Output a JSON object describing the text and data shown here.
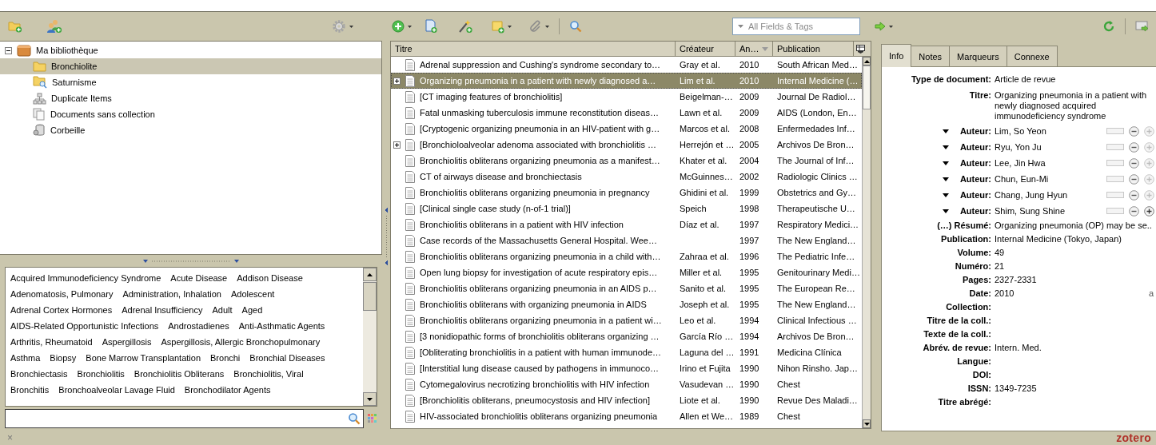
{
  "toolbar": {
    "search_placeholder": "All Fields & Tags"
  },
  "collections": [
    {
      "label": "Ma bibliothèque",
      "kind": "library",
      "expanded": true,
      "selected": false,
      "children": [
        {
          "label": "Bronchiolite",
          "kind": "folder",
          "selected": true
        },
        {
          "label": "Saturnisme",
          "kind": "saved-search",
          "selected": false
        },
        {
          "label": "Duplicate Items",
          "kind": "duplicates",
          "selected": false
        },
        {
          "label": "Documents sans collection",
          "kind": "unfiled",
          "selected": false
        },
        {
          "label": "Corbeille",
          "kind": "trash",
          "selected": false
        }
      ]
    }
  ],
  "tag_rows": [
    {
      "tags": [
        "Acquired Immunodeficiency Syndrome",
        "Acute Disease",
        "Addison Disease"
      ]
    },
    {
      "tags": [
        "Adenomatosis, Pulmonary",
        "Administration, Inhalation",
        "Adolescent"
      ]
    },
    {
      "tags": [
        "Adrenal Cortex Hormones",
        "Adrenal Insufficiency",
        "Adult",
        "Aged"
      ]
    },
    {
      "tags": [
        "AIDS-Related Opportunistic Infections",
        "Androstadienes",
        "Anti-Asthmatic Agents"
      ]
    },
    {
      "tags": [
        "Arthritis, Rheumatoid",
        "Aspergillosis",
        "Aspergillosis, Allergic Bronchopulmonary"
      ]
    },
    {
      "tags": [
        "Asthma",
        "Biopsy",
        "Bone Marrow Transplantation",
        "Bronchi",
        "Bronchial Diseases"
      ]
    },
    {
      "tags": [
        "Bronchiectasis",
        "Bronchiolitis",
        "Bronchiolitis Obliterans",
        "Bronchiolitis, Viral"
      ]
    },
    {
      "tags": [
        "Bronchitis",
        "Bronchoalveolar Lavage Fluid",
        "Bronchodilator Agents"
      ]
    }
  ],
  "items": {
    "columns": [
      {
        "label": "Titre",
        "sorted": false
      },
      {
        "label": "Créateur",
        "sorted": false
      },
      {
        "label": "An…",
        "sorted": true
      },
      {
        "label": "Publication",
        "sorted": false
      }
    ],
    "rows": [
      {
        "title": "Adrenal suppression and Cushing's syndrome secondary to…",
        "creator": "Gray et al.",
        "year": "2010",
        "publication": "South African Med…",
        "expandable": false,
        "selected": false
      },
      {
        "title": "Organizing pneumonia in a patient with newly diagnosed a…",
        "creator": "Lim et al.",
        "year": "2010",
        "publication": "Internal Medicine (…",
        "expandable": true,
        "selected": true
      },
      {
        "title": "[CT imaging features of bronchiolitis]",
        "creator": "Beigelman-…",
        "year": "2009",
        "publication": "Journal De Radiol…",
        "expandable": false,
        "selected": false
      },
      {
        "title": "Fatal unmasking tuberculosis immune reconstitution diseas…",
        "creator": "Lawn et al.",
        "year": "2009",
        "publication": "AIDS (London, En…",
        "expandable": false,
        "selected": false
      },
      {
        "title": "[Cryptogenic organizing pneumonia in an HIV-patient with g…",
        "creator": "Marcos et al.",
        "year": "2008",
        "publication": "Enfermedades Inf…",
        "expandable": false,
        "selected": false
      },
      {
        "title": "[Bronchioloalveolar adenoma associated with bronchiolitis …",
        "creator": "Herrejón et …",
        "year": "2005",
        "publication": "Archivos De Bron…",
        "expandable": true,
        "selected": false
      },
      {
        "title": "Bronchiolitis obliterans organizing pneumonia as a manifest…",
        "creator": "Khater et al.",
        "year": "2004",
        "publication": "The Journal of Inf…",
        "expandable": false,
        "selected": false
      },
      {
        "title": "CT of airways disease and bronchiectasis",
        "creator": "McGuinnes…",
        "year": "2002",
        "publication": "Radiologic Clinics …",
        "expandable": false,
        "selected": false
      },
      {
        "title": "Bronchiolitis obliterans organizing pneumonia in pregnancy",
        "creator": "Ghidini et al.",
        "year": "1999",
        "publication": "Obstetrics and Gy…",
        "expandable": false,
        "selected": false
      },
      {
        "title": "[Clinical single case study (n-of-1 trial)]",
        "creator": "Speich",
        "year": "1998",
        "publication": "Therapeutische U…",
        "expandable": false,
        "selected": false
      },
      {
        "title": "Bronchiolitis obliterans in a patient with HIV infection",
        "creator": "Díaz et al.",
        "year": "1997",
        "publication": "Respiratory Medici…",
        "expandable": false,
        "selected": false
      },
      {
        "title": "Case records of the Massachusetts General Hospital. Wee…",
        "year": "1997",
        "publication": "The New England…",
        "expandable": false,
        "selected": false
      },
      {
        "title": "Bronchiolitis obliterans organizing pneumonia in a child with…",
        "creator": "Zahraa et al.",
        "year": "1996",
        "publication": "The Pediatric Infe…",
        "expandable": false,
        "selected": false
      },
      {
        "title": "Open lung biopsy for investigation of acute respiratory epis…",
        "creator": "Miller et al.",
        "year": "1995",
        "publication": "Genitourinary Medi…",
        "expandable": false,
        "selected": false
      },
      {
        "title": "Bronchiolitis obliterans organizing pneumonia in an AIDS p…",
        "creator": "Sanito et al.",
        "year": "1995",
        "publication": "The European Re…",
        "expandable": false,
        "selected": false
      },
      {
        "title": "Bronchiolitis obliterans with organizing pneumonia in AIDS",
        "creator": "Joseph et al.",
        "year": "1995",
        "publication": "The New England…",
        "expandable": false,
        "selected": false
      },
      {
        "title": "Bronchiolitis obliterans organizing pneumonia in a patient wi…",
        "creator": "Leo et al.",
        "year": "1994",
        "publication": "Clinical Infectious …",
        "expandable": false,
        "selected": false
      },
      {
        "title": "[3 nonidiopathic forms of bronchiolitis obliterans organizing …",
        "creator": "García Río …",
        "year": "1994",
        "publication": "Archivos De Bron…",
        "expandable": false,
        "selected": false
      },
      {
        "title": "[Obliterating bronchiolitis in a patient with human immunode…",
        "creator": "Laguna del …",
        "year": "1991",
        "publication": "Medicina Clínica",
        "expandable": false,
        "selected": false
      },
      {
        "title": "[Interstitial lung disease caused by pathogens in immunoco…",
        "creator": "Irino et Fujita",
        "year": "1990",
        "publication": "Nihon Rinsho. Jap…",
        "expandable": false,
        "selected": false
      },
      {
        "title": "Cytomegalovirus necrotizing bronchiolitis with HIV infection",
        "creator": "Vasudevan …",
        "year": "1990",
        "publication": "Chest",
        "expandable": false,
        "selected": false
      },
      {
        "title": "[Bronchiolitis obliterans, pneumocystosis and HIV infection]",
        "creator": "Liote et al.",
        "year": "1990",
        "publication": "Revue Des Maladi…",
        "expandable": false,
        "selected": false
      },
      {
        "title": "HIV-associated bronchiolitis obliterans organizing pneumonia",
        "creator": "Allen et We…",
        "year": "1989",
        "publication": "Chest",
        "expandable": false,
        "selected": false
      }
    ]
  },
  "info": {
    "tabs": [
      {
        "label": "Info",
        "selected": true
      },
      {
        "label": "Notes",
        "selected": false
      },
      {
        "label": "Marqueurs",
        "selected": false
      },
      {
        "label": "Connexe",
        "selected": false
      }
    ],
    "fields": [
      {
        "kind": "field",
        "label": "Type de document:",
        "value": "Article de revue"
      },
      {
        "kind": "field",
        "label": "Titre:",
        "value": "Organizing pneumonia in a patient with newly diagnosed acquired immunodeficiency syndrome"
      },
      {
        "kind": "creator",
        "label": "Auteur:",
        "value": "Lim, So Yeon",
        "plus_disabled": true
      },
      {
        "kind": "creator",
        "label": "Auteur:",
        "value": "Ryu, Yon Ju",
        "plus_disabled": true
      },
      {
        "kind": "creator",
        "label": "Auteur:",
        "value": "Lee, Jin Hwa",
        "plus_disabled": true
      },
      {
        "kind": "creator",
        "label": "Auteur:",
        "value": "Chun, Eun-Mi",
        "plus_disabled": true
      },
      {
        "kind": "creator",
        "label": "Auteur:",
        "value": "Chang, Jung Hyun",
        "plus_disabled": true
      },
      {
        "kind": "creator",
        "label": "Auteur:",
        "value": "Shim, Sung Shine",
        "plus_disabled": false
      },
      {
        "kind": "field",
        "label": "(…) Résumé:",
        "value": "Organizing pneumonia (OP) may be se.."
      },
      {
        "kind": "field",
        "label": "Publication:",
        "value": "Internal Medicine (Tokyo, Japan)"
      },
      {
        "kind": "field",
        "label": "Volume:",
        "value": "49"
      },
      {
        "kind": "field",
        "label": "Numéro:",
        "value": "21"
      },
      {
        "kind": "field",
        "label": "Pages:",
        "value": "2327-2331"
      },
      {
        "kind": "field",
        "label": "Date:",
        "value": "2010",
        "hint": "a"
      },
      {
        "kind": "field",
        "label": "Collection:"
      },
      {
        "kind": "field",
        "label": "Titre de la coll.:"
      },
      {
        "kind": "field",
        "label": "Texte de la coll.:"
      },
      {
        "kind": "field",
        "label": "Abrév. de revue:",
        "value": "Intern. Med."
      },
      {
        "kind": "field",
        "label": "Langue:"
      },
      {
        "kind": "field",
        "label": "DOI:"
      },
      {
        "kind": "field",
        "label": "ISSN:",
        "value": "1349-7235"
      },
      {
        "kind": "field",
        "label": "Titre abrégé:"
      }
    ]
  },
  "status": {
    "close": "×",
    "logo": "zotero"
  }
}
